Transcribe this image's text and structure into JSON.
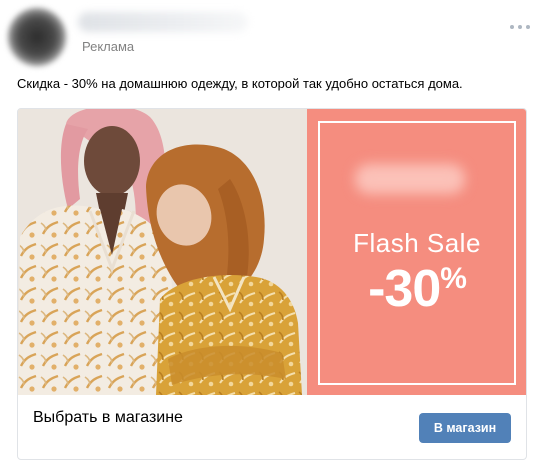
{
  "post": {
    "ad_label": "Реклама",
    "text": "Скидка - 30% на домашнюю одежду, в которой так удобно остаться дома."
  },
  "banner": {
    "headline": "Flash Sale",
    "discount": "-30",
    "percent_sign": "%",
    "color": "#f58d7f"
  },
  "card": {
    "title": "Выбрать в магазине",
    "button_label": "В магазин",
    "button_color": "#5181b8"
  }
}
